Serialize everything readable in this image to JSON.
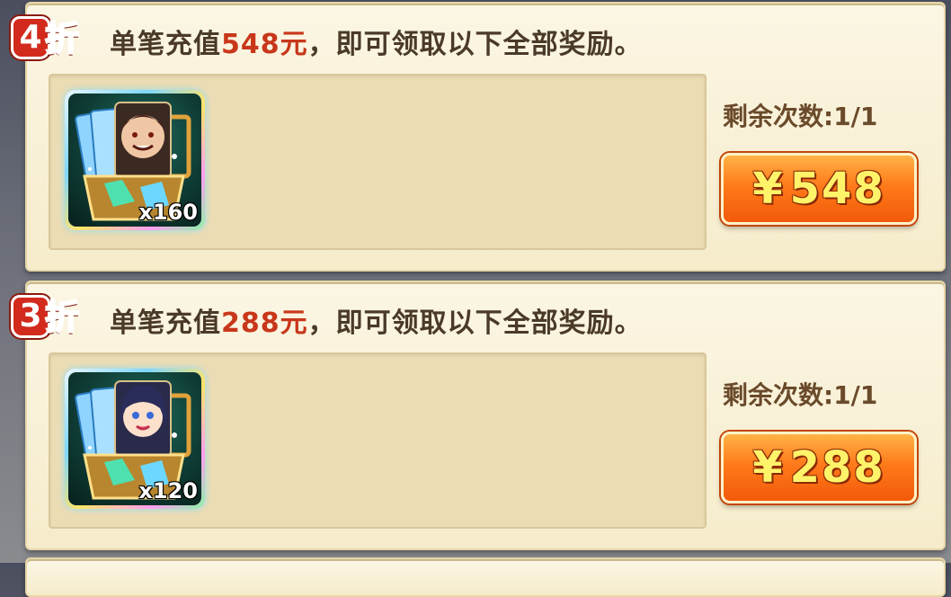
{
  "offers": [
    {
      "discount_num": "4",
      "discount_char": "折",
      "title_prefix": "单笔充值",
      "amount_text": "548元",
      "title_suffix": "，即可领取以下全部奖励。",
      "item_icon": "hero-card-box-icon",
      "item_qty": "x160",
      "remaining": "剩余次数:1/1",
      "price_symbol": "¥",
      "price": "548"
    },
    {
      "discount_num": "3",
      "discount_char": "折",
      "title_prefix": "单笔充值",
      "amount_text": "288元",
      "title_suffix": "，即可领取以下全部奖励。",
      "item_icon": "hero-card-box-icon",
      "item_qty": "x120",
      "remaining": "剩余次数:1/1",
      "price_symbol": "¥",
      "price": "288"
    }
  ],
  "colors": {
    "accent_red": "#c8371a",
    "button_orange": "#ff7a1a",
    "price_yellow": "#fff36a",
    "panel_bg": "#f6eccb"
  }
}
